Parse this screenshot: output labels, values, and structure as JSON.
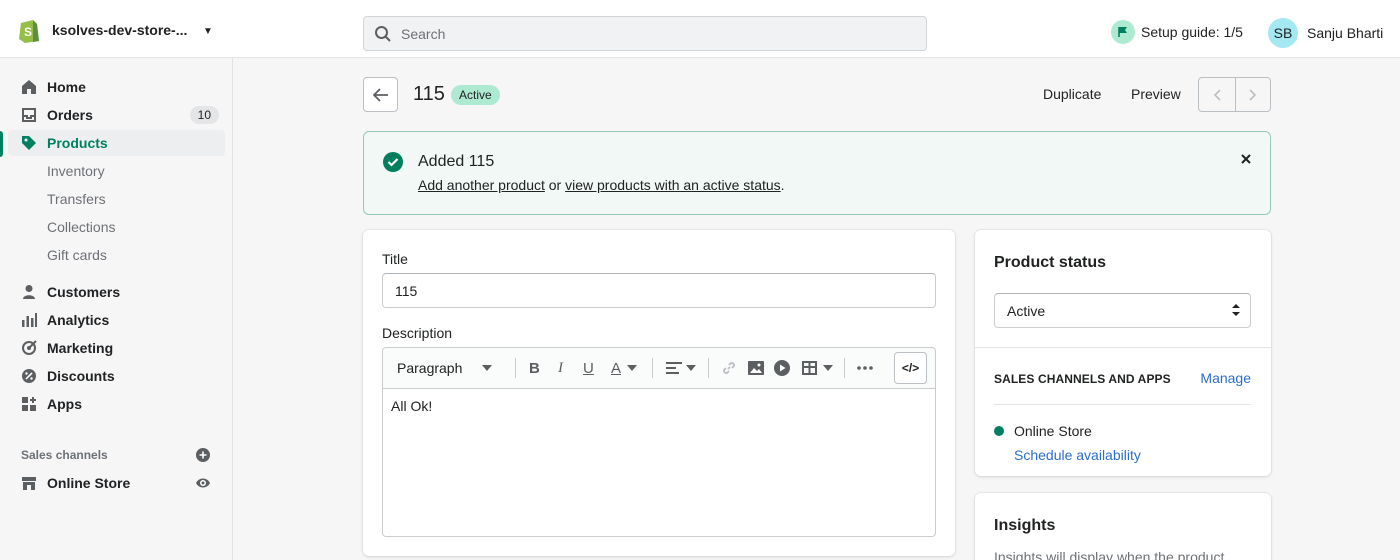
{
  "store": {
    "name": "ksolves-dev-store-..."
  },
  "search": {
    "placeholder": "Search"
  },
  "setup_guide": {
    "label": "Setup guide: 1/5"
  },
  "user": {
    "initials": "SB",
    "name": "Sanju Bharti"
  },
  "sidebar": {
    "items": [
      {
        "label": "Home"
      },
      {
        "label": "Orders",
        "badge": "10"
      },
      {
        "label": "Products"
      },
      {
        "label": "Inventory"
      },
      {
        "label": "Transfers"
      },
      {
        "label": "Collections"
      },
      {
        "label": "Gift cards"
      },
      {
        "label": "Customers"
      },
      {
        "label": "Analytics"
      },
      {
        "label": "Marketing"
      },
      {
        "label": "Discounts"
      },
      {
        "label": "Apps"
      }
    ],
    "sales_channels_title": "Sales channels",
    "online_store": "Online Store"
  },
  "header": {
    "title": "115",
    "status": "Active",
    "duplicate": "Duplicate",
    "preview": "Preview"
  },
  "banner": {
    "title": "Added 115",
    "link1": "Add another product",
    "connector": " or ",
    "link2": "view products with an active status",
    "end": "."
  },
  "form": {
    "title_label": "Title",
    "title_value": "115",
    "description_label": "Description",
    "paragraph": "Paragraph",
    "code_label": "</>",
    "description_value": "All Ok!"
  },
  "status_card": {
    "title": "Product status",
    "selected": "Active",
    "channels_title": "SALES CHANNELS AND APPS",
    "manage": "Manage",
    "channel": "Online Store",
    "schedule": "Schedule availability"
  },
  "insights": {
    "title": "Insights",
    "desc": "Insights will display when the product"
  },
  "colors": {
    "accent": "#008060",
    "link": "#2c6ecb",
    "badge": "#aee9d1"
  }
}
